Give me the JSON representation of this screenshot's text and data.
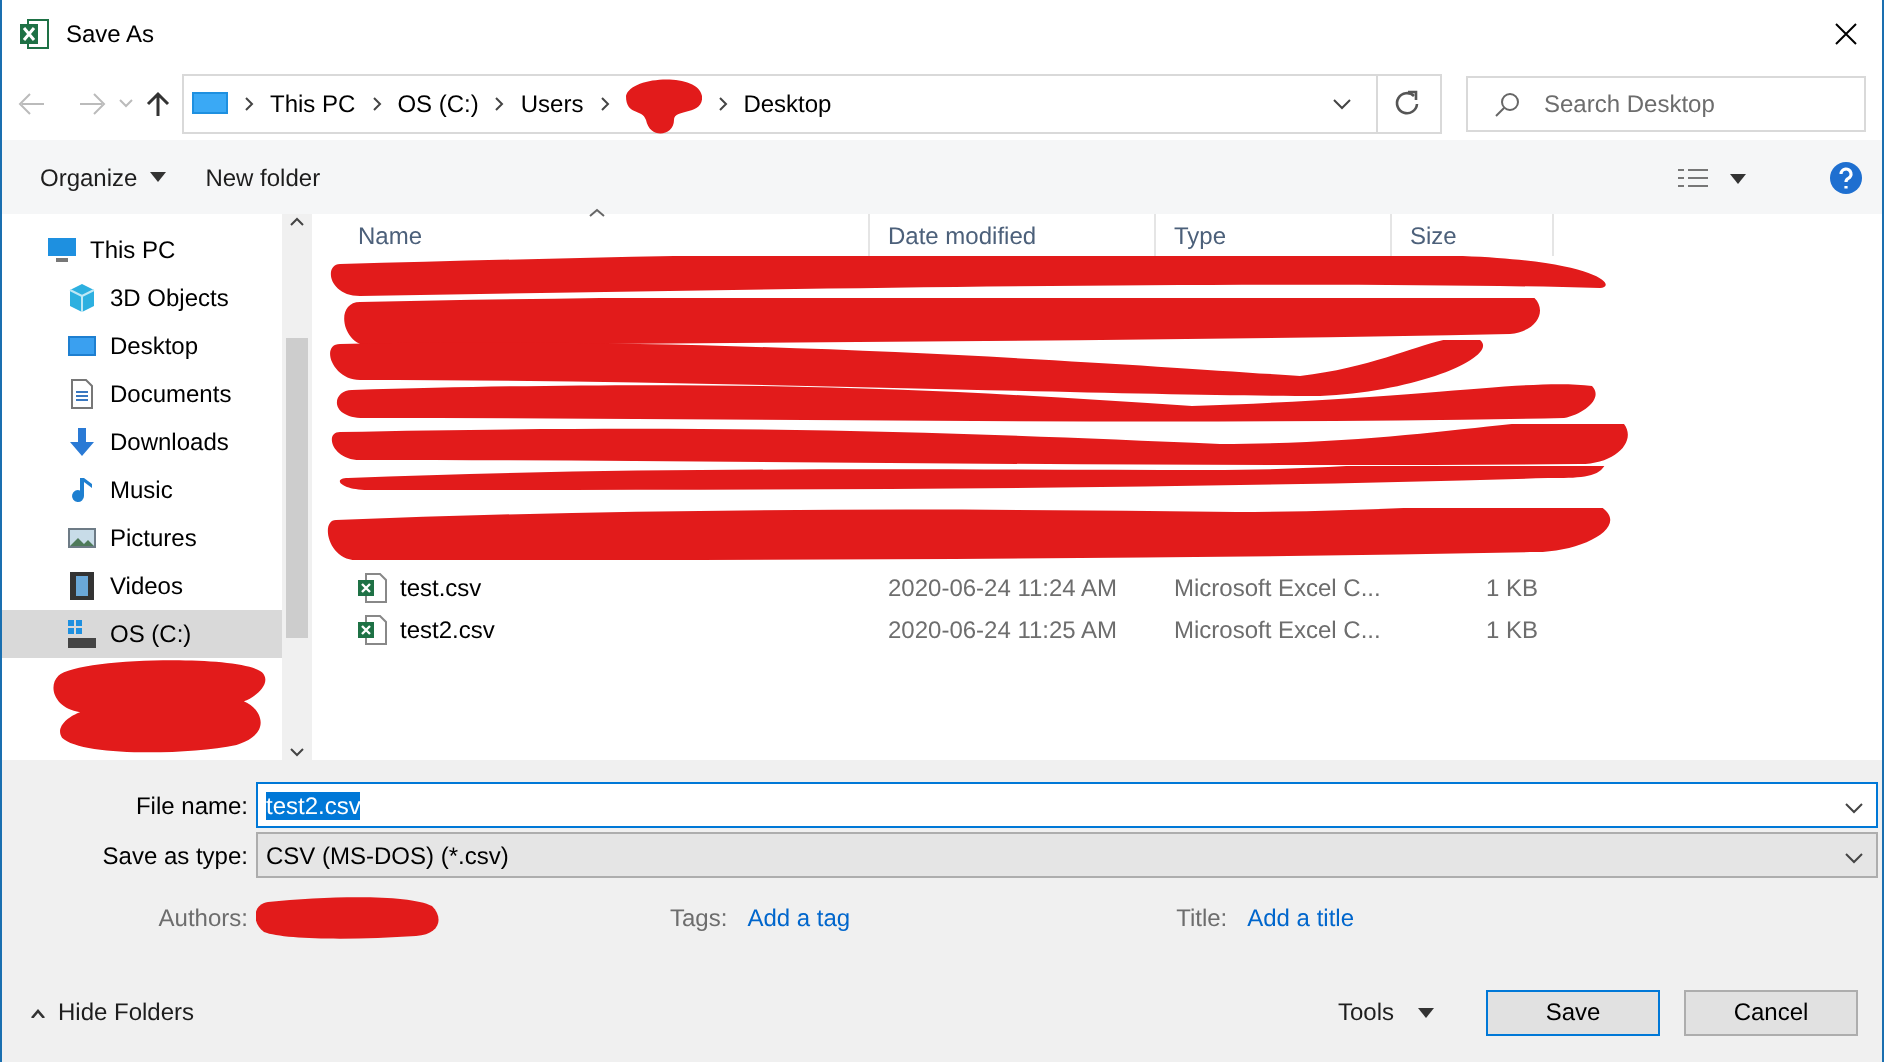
{
  "window": {
    "title": "Save As"
  },
  "address": {
    "crumbs": [
      {
        "label": "This PC"
      },
      {
        "label": "OS (C:)"
      },
      {
        "label": "Users"
      },
      {
        "redacted": true
      },
      {
        "label": "Desktop"
      }
    ]
  },
  "search": {
    "placeholder": "Search Desktop"
  },
  "toolbar": {
    "organize": "Organize",
    "new_folder": "New folder"
  },
  "sidebar": {
    "items": [
      {
        "label": "This PC",
        "kind": "pc",
        "selected": false,
        "children": [
          {
            "label": "3D Objects",
            "kind": "cube",
            "selected": false
          },
          {
            "label": "Desktop",
            "kind": "desktop",
            "selected": false
          },
          {
            "label": "Documents",
            "kind": "documents",
            "selected": false
          },
          {
            "label": "Downloads",
            "kind": "downloads",
            "selected": false
          },
          {
            "label": "Music",
            "kind": "music",
            "selected": false
          },
          {
            "label": "Pictures",
            "kind": "pictures",
            "selected": false
          },
          {
            "label": "Videos",
            "kind": "videos",
            "selected": false
          },
          {
            "label": "OS (C:)",
            "kind": "drive",
            "selected": true
          },
          {
            "redacted": true
          }
        ]
      }
    ]
  },
  "table": {
    "columns": [
      "Name",
      "Date modified",
      "Type",
      "Size"
    ],
    "rows": [
      {
        "redacted": true
      },
      {
        "redacted": true
      },
      {
        "redacted": true
      },
      {
        "redacted": true
      },
      {
        "redacted": true
      },
      {
        "redacted": true
      },
      {
        "redacted": true
      },
      {
        "name": "test.csv",
        "date": "2020-06-24 11:24 AM",
        "type": "Microsoft Excel C...",
        "size": "1 KB"
      },
      {
        "name": "test2.csv",
        "date": "2020-06-24 11:25 AM",
        "type": "Microsoft Excel C...",
        "size": "1 KB"
      }
    ]
  },
  "form": {
    "file_name_label": "File name:",
    "file_name": "test2.csv",
    "type_label": "Save as type:",
    "type": "CSV (MS-DOS) (*.csv)",
    "authors_label": "Authors:",
    "tags_label": "Tags:",
    "tags_link": "Add a tag",
    "title_label": "Title:",
    "title_link": "Add a title"
  },
  "footer": {
    "hide_folders": "Hide Folders",
    "tools": "Tools",
    "save": "Save",
    "cancel": "Cancel"
  }
}
